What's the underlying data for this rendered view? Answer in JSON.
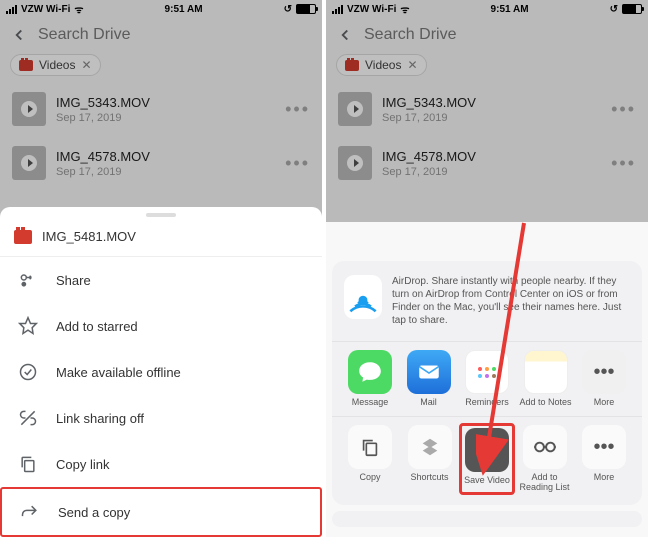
{
  "status": {
    "carrier": "VZW Wi-Fi",
    "time": "9:51 AM"
  },
  "drive": {
    "search_placeholder": "Search Drive",
    "chip": {
      "label": "Videos"
    },
    "files": [
      {
        "name": "IMG_5343.MOV",
        "date": "Sep 17, 2019"
      },
      {
        "name": "IMG_4578.MOV",
        "date": "Sep 17, 2019"
      }
    ]
  },
  "sheet_left": {
    "filename": "IMG_5481.MOV",
    "items": {
      "share": "Share",
      "starred": "Add to starred",
      "offline": "Make available offline",
      "linksharing": "Link sharing off",
      "copylink": "Copy link",
      "sendcopy": "Send a copy"
    }
  },
  "sheet_right": {
    "airdrop": "AirDrop. Share instantly with people nearby. If they turn on AirDrop from Control Center on iOS or from Finder on the Mac, you'll see their names here. Just tap to share.",
    "apps": {
      "message": "Message",
      "mail": "Mail",
      "reminders": "Reminders",
      "notes": "Add to Notes",
      "more": "More"
    },
    "actions": {
      "copy": "Copy",
      "shortcuts": "Shortcuts",
      "savevideo": "Save Video",
      "readinglist": "Add to\nReading List",
      "more": "More"
    }
  }
}
